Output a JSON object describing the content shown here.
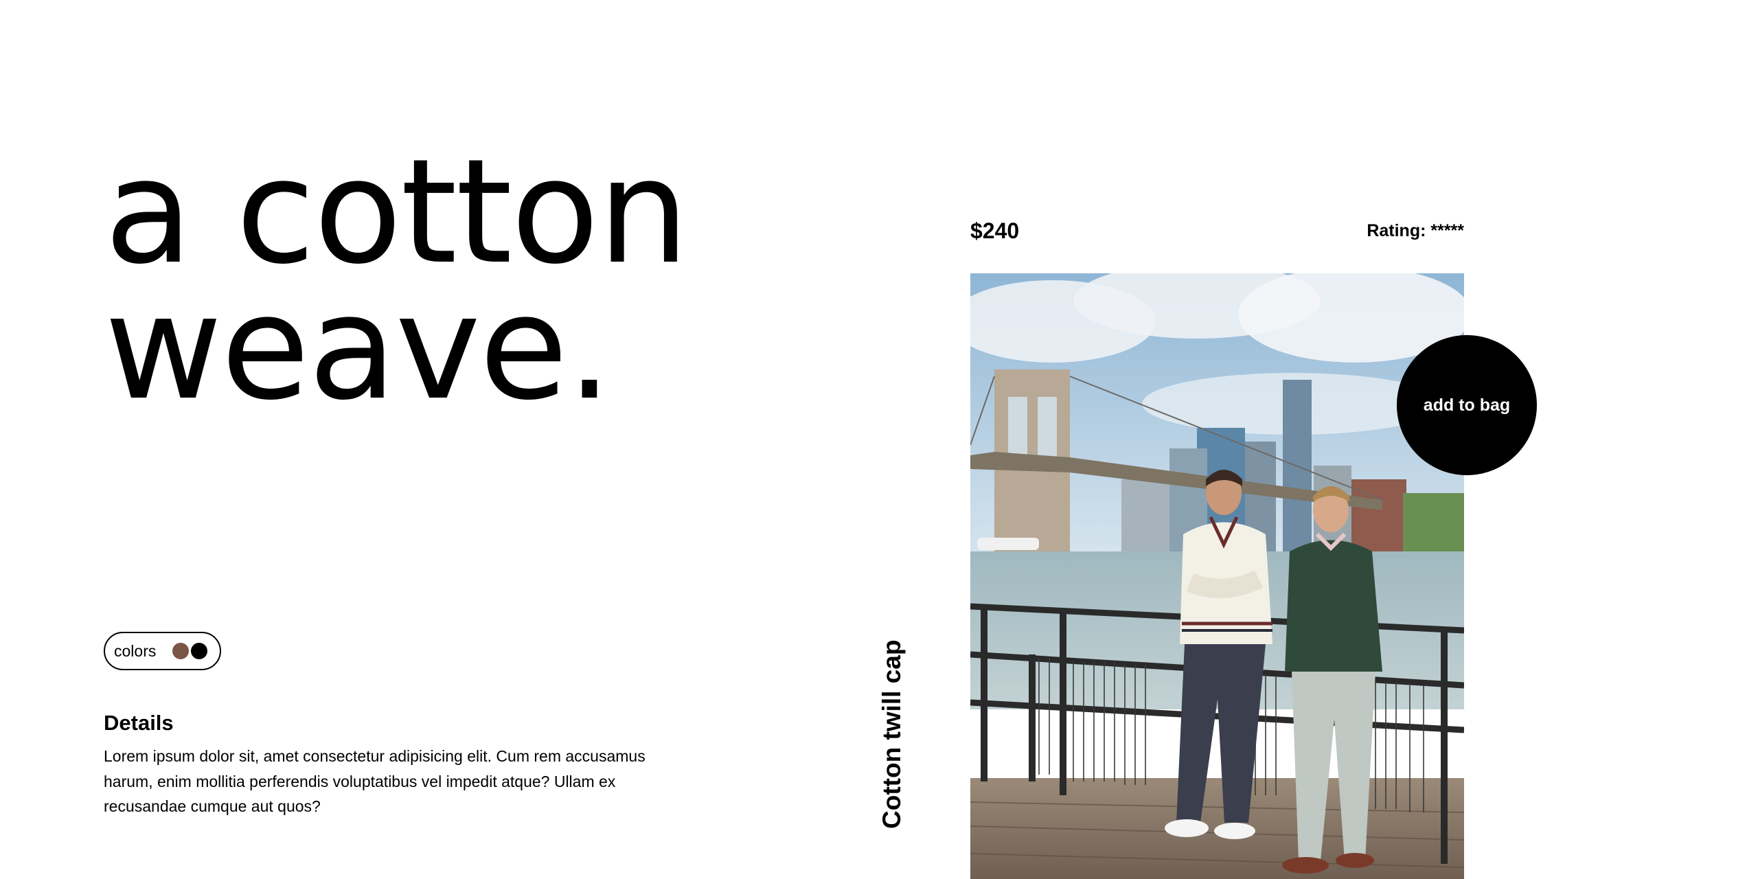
{
  "hero": {
    "line1": "a cotton",
    "line2": "weave."
  },
  "colors": {
    "label": "colors",
    "swatches": [
      {
        "name": "brown",
        "hex": "#7a5646"
      },
      {
        "name": "black",
        "hex": "#000000"
      }
    ]
  },
  "details": {
    "title": "Details",
    "text": "Lorem ipsum dolor sit, amet consectetur adipisicing elit. Cum rem accusamus harum, enim mollitia perferendis voluptatibus vel impedit atque? Ullam ex recusandae cumque aut quos?"
  },
  "product": {
    "price": "$240",
    "rating": "Rating: *****",
    "name": "Cotton twill cap",
    "add_to_bag": "add to bag"
  }
}
